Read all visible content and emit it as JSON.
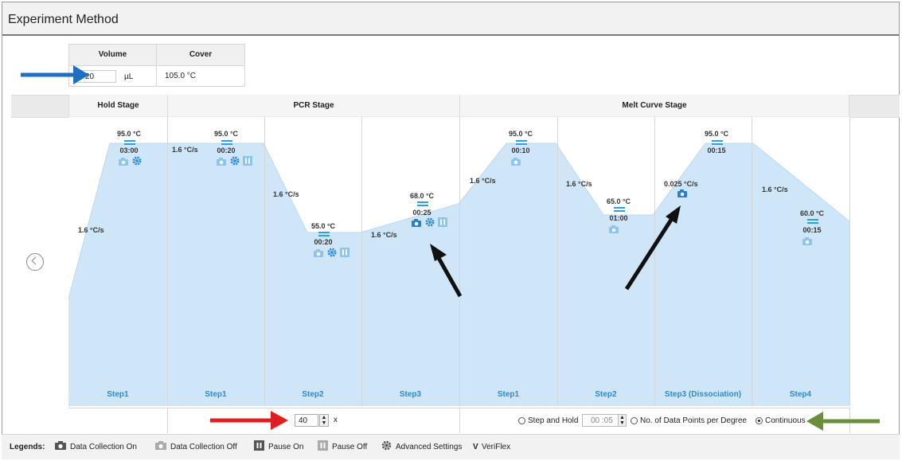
{
  "header": {
    "title": "Experiment Method"
  },
  "settings": {
    "volume_label": "Volume",
    "cover_label": "Cover",
    "volume_value": "20",
    "volume_unit": "µL",
    "cover_value": "105.0 °C"
  },
  "stages": [
    {
      "name": "Hold Stage"
    },
    {
      "name": "PCR Stage"
    },
    {
      "name": "Melt Curve Stage"
    }
  ],
  "steps": [
    {
      "label": "Step1",
      "temp": "95.0 °C",
      "time": "03:00",
      "ramp": "1.6 °C/s"
    },
    {
      "label": "Step1",
      "temp": "95.0 °C",
      "time": "00:20",
      "ramp": "1.6 °C/s"
    },
    {
      "label": "Step2",
      "temp": "55.0 °C",
      "time": "00:20",
      "ramp": "1.6 °C/s"
    },
    {
      "label": "Step3",
      "temp": "68.0 °C",
      "time": "00:25",
      "ramp": "1.6 °C/s"
    },
    {
      "label": "Step1",
      "temp": "95.0 °C",
      "time": "00:10",
      "ramp": "1.6 °C/s"
    },
    {
      "label": "Step2",
      "temp": "65.0 °C",
      "time": "01:00",
      "ramp": "1.6 °C/s"
    },
    {
      "label": "Step3 (Dissociation)",
      "temp": "95.0 °C",
      "time": "00:15",
      "ramp": "0.025 °C/s"
    },
    {
      "label": "Step4",
      "temp": "60.0 °C",
      "time": "00:15",
      "ramp": "1.6 °C/s"
    }
  ],
  "pcr": {
    "cycles": "40",
    "cycles_suffix": "x"
  },
  "melt": {
    "step_and_hold": "Step and Hold",
    "hold_time": "00 :05",
    "data_points": "No. of Data Points per Degree",
    "continuous": "Continuous",
    "selected": "Continuous"
  },
  "legend": {
    "title": "Legends:",
    "items": [
      "Data Collection On",
      "Data Collection Off",
      "Pause On",
      "Pause Off",
      "Advanced Settings",
      "VeriFlex"
    ],
    "veriflex_symbol": "V"
  },
  "colors": {
    "fill": "#cfe6f8",
    "accent": "#2a8bd6",
    "hold": "#2aa0e8",
    "icon_on": "#2a7fc8",
    "icon_off": "#8cc4ee",
    "arrow_blue": "#1f6fc0",
    "arrow_red": "#e02020",
    "arrow_black": "#111111",
    "arrow_green": "#6a8f3a"
  }
}
